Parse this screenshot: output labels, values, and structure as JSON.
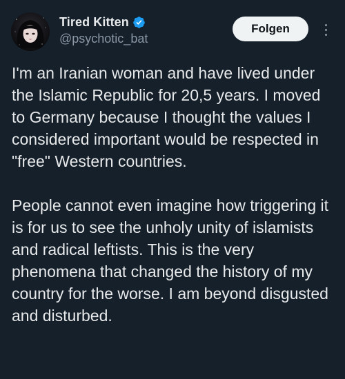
{
  "author": {
    "display_name": "Tired Kitten",
    "handle": "@psychotic_bat",
    "verified": true,
    "verified_icon": "verified-badge-icon",
    "accent_color": "#1d9bf0"
  },
  "actions": {
    "follow_label": "Folgen",
    "more_icon": "more-vertical-icon"
  },
  "tweet": {
    "paragraphs": [
      "I'm an Iranian woman and have lived under the Islamic Republic for 20,5 years. I moved to Germany because I thought the values I considered important would be respected in \"free\" Western countries.",
      "People cannot even imagine how triggering it is for us to see the unholy unity of islamists and radical leftists. This is the very phenomena that changed the history of my country for the worse. I am beyond disgusted and disturbed."
    ]
  },
  "colors": {
    "background": "#15202b",
    "text_primary": "#e7e9ea",
    "text_secondary": "#8b98a5",
    "button_bg": "#eff3f4",
    "button_text": "#0f1419"
  }
}
